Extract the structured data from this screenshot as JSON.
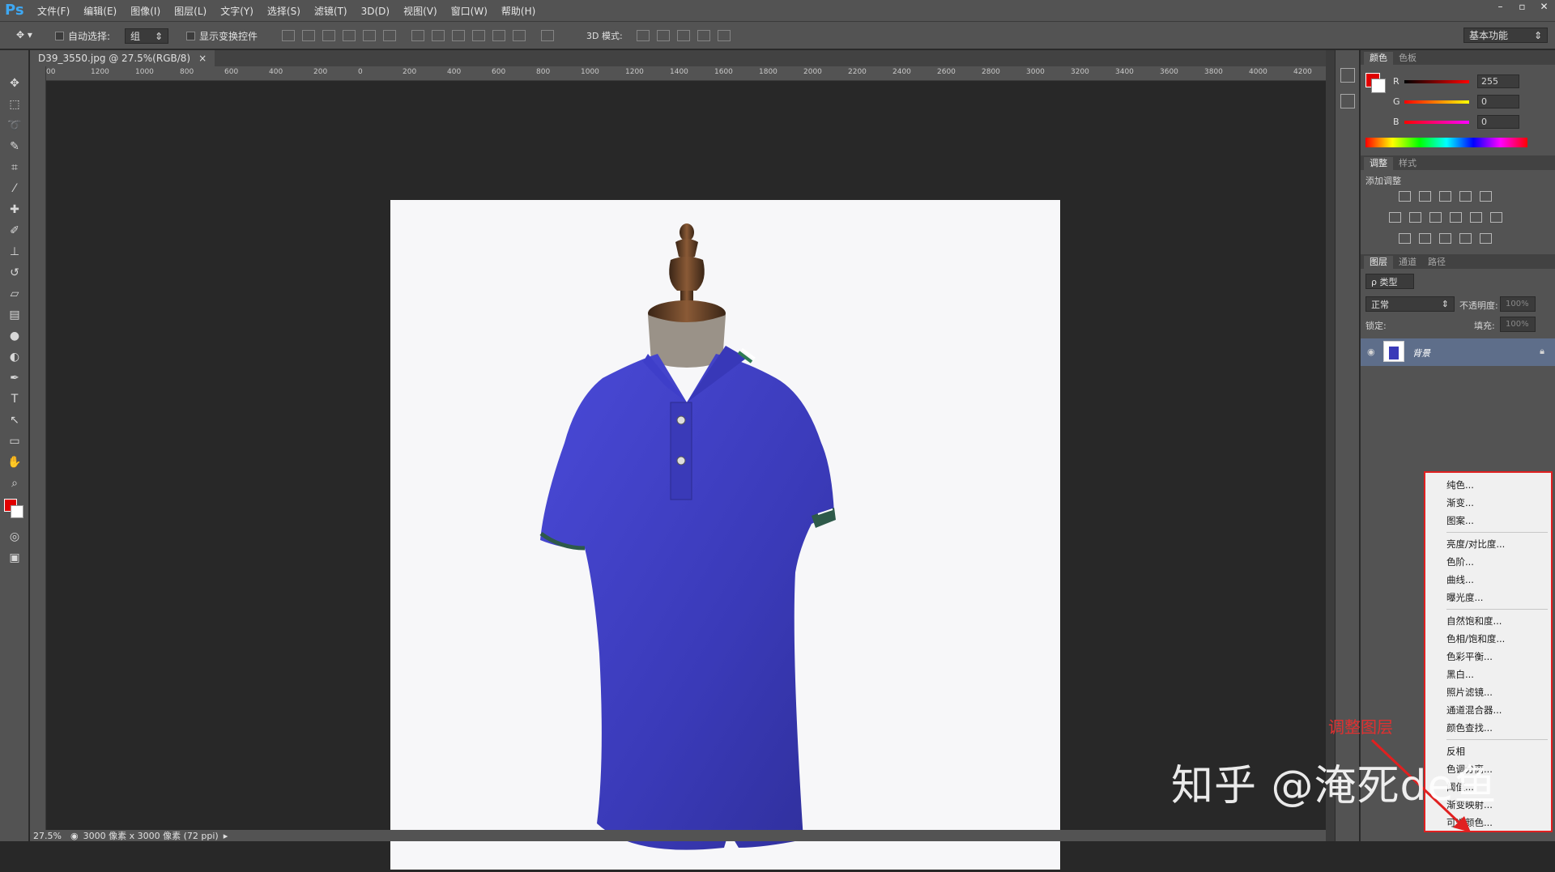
{
  "app": {
    "logo": "Ps"
  },
  "menu": [
    "文件(F)",
    "编辑(E)",
    "图像(I)",
    "图层(L)",
    "文字(Y)",
    "选择(S)",
    "滤镜(T)",
    "3D(D)",
    "视图(V)",
    "窗口(W)",
    "帮助(H)"
  ],
  "window_controls": [
    "–",
    "▫",
    "✕"
  ],
  "options": {
    "auto_select_label": "自动选择:",
    "auto_select_value": "组",
    "show_transform_label": "显示变换控件",
    "mode3d_label": "3D 模式:",
    "workspace": "基本功能"
  },
  "document": {
    "tab_title": "D39_3550.jpg @ 27.5%(RGB/8)",
    "close_glyph": "×",
    "ruler_ticks": [
      "00",
      "1200",
      "1000",
      "800",
      "600",
      "400",
      "200",
      "0",
      "200",
      "400",
      "600",
      "800",
      "1000",
      "1200",
      "1400",
      "1600",
      "1800",
      "2000",
      "2200",
      "2400",
      "2600",
      "2800",
      "3000",
      "3200",
      "3400",
      "3600",
      "3800",
      "4000",
      "4200"
    ]
  },
  "status": {
    "zoom": "27.5%",
    "info": "3000 像素 x 3000 像素 (72 ppi)"
  },
  "color_panel": {
    "tabs": [
      "颜色",
      "色板"
    ],
    "r_label": "R",
    "g_label": "G",
    "b_label": "B",
    "r": "255",
    "g": "0",
    "b": "0",
    "fg_color": "#e00000"
  },
  "adjust_panel": {
    "tabs": [
      "调整",
      "样式"
    ],
    "title": "添加调整"
  },
  "layers_panel": {
    "tabs": [
      "图层",
      "通道",
      "路径"
    ],
    "filter_label": "ρ 类型",
    "blend_mode": "正常",
    "opacity_label": "不透明度:",
    "opacity_value": "100%",
    "lock_label": "锁定:",
    "fill_label": "填充:",
    "fill_value": "100%",
    "layer_name": "背景"
  },
  "context_menu": {
    "group1": [
      "纯色...",
      "渐变...",
      "图案..."
    ],
    "group2": [
      "亮度/对比度...",
      "色阶...",
      "曲线...",
      "曝光度..."
    ],
    "group3": [
      "自然饱和度...",
      "色相/饱和度...",
      "色彩平衡...",
      "黑白...",
      "照片滤镜...",
      "通道混合器...",
      "颜色查找..."
    ],
    "group4": [
      "反相",
      "色调分离...",
      "阈值...",
      "渐变映射...",
      "可选颜色..."
    ]
  },
  "annotation": "调整图层",
  "watermark": "知乎 @淹死de鱼"
}
